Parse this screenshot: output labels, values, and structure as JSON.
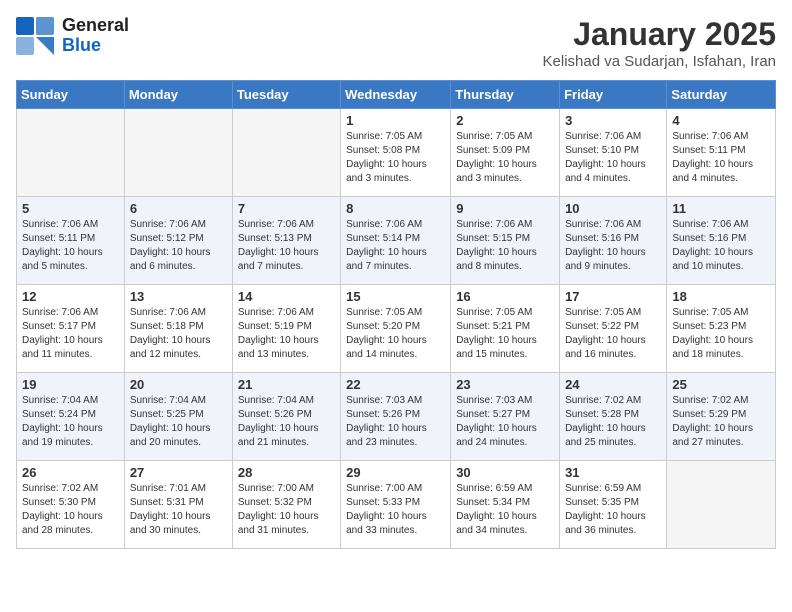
{
  "header": {
    "logo_line1": "General",
    "logo_line2": "Blue",
    "month": "January 2025",
    "location": "Kelishad va Sudarjan, Isfahan, Iran"
  },
  "weekdays": [
    "Sunday",
    "Monday",
    "Tuesday",
    "Wednesday",
    "Thursday",
    "Friday",
    "Saturday"
  ],
  "weeks": [
    [
      {
        "day": "",
        "info": ""
      },
      {
        "day": "",
        "info": ""
      },
      {
        "day": "",
        "info": ""
      },
      {
        "day": "1",
        "info": "Sunrise: 7:05 AM\nSunset: 5:08 PM\nDaylight: 10 hours\nand 3 minutes."
      },
      {
        "day": "2",
        "info": "Sunrise: 7:05 AM\nSunset: 5:09 PM\nDaylight: 10 hours\nand 3 minutes."
      },
      {
        "day": "3",
        "info": "Sunrise: 7:06 AM\nSunset: 5:10 PM\nDaylight: 10 hours\nand 4 minutes."
      },
      {
        "day": "4",
        "info": "Sunrise: 7:06 AM\nSunset: 5:11 PM\nDaylight: 10 hours\nand 4 minutes."
      }
    ],
    [
      {
        "day": "5",
        "info": "Sunrise: 7:06 AM\nSunset: 5:11 PM\nDaylight: 10 hours\nand 5 minutes."
      },
      {
        "day": "6",
        "info": "Sunrise: 7:06 AM\nSunset: 5:12 PM\nDaylight: 10 hours\nand 6 minutes."
      },
      {
        "day": "7",
        "info": "Sunrise: 7:06 AM\nSunset: 5:13 PM\nDaylight: 10 hours\nand 7 minutes."
      },
      {
        "day": "8",
        "info": "Sunrise: 7:06 AM\nSunset: 5:14 PM\nDaylight: 10 hours\nand 7 minutes."
      },
      {
        "day": "9",
        "info": "Sunrise: 7:06 AM\nSunset: 5:15 PM\nDaylight: 10 hours\nand 8 minutes."
      },
      {
        "day": "10",
        "info": "Sunrise: 7:06 AM\nSunset: 5:16 PM\nDaylight: 10 hours\nand 9 minutes."
      },
      {
        "day": "11",
        "info": "Sunrise: 7:06 AM\nSunset: 5:16 PM\nDaylight: 10 hours\nand 10 minutes."
      }
    ],
    [
      {
        "day": "12",
        "info": "Sunrise: 7:06 AM\nSunset: 5:17 PM\nDaylight: 10 hours\nand 11 minutes."
      },
      {
        "day": "13",
        "info": "Sunrise: 7:06 AM\nSunset: 5:18 PM\nDaylight: 10 hours\nand 12 minutes."
      },
      {
        "day": "14",
        "info": "Sunrise: 7:06 AM\nSunset: 5:19 PM\nDaylight: 10 hours\nand 13 minutes."
      },
      {
        "day": "15",
        "info": "Sunrise: 7:05 AM\nSunset: 5:20 PM\nDaylight: 10 hours\nand 14 minutes."
      },
      {
        "day": "16",
        "info": "Sunrise: 7:05 AM\nSunset: 5:21 PM\nDaylight: 10 hours\nand 15 minutes."
      },
      {
        "day": "17",
        "info": "Sunrise: 7:05 AM\nSunset: 5:22 PM\nDaylight: 10 hours\nand 16 minutes."
      },
      {
        "day": "18",
        "info": "Sunrise: 7:05 AM\nSunset: 5:23 PM\nDaylight: 10 hours\nand 18 minutes."
      }
    ],
    [
      {
        "day": "19",
        "info": "Sunrise: 7:04 AM\nSunset: 5:24 PM\nDaylight: 10 hours\nand 19 minutes."
      },
      {
        "day": "20",
        "info": "Sunrise: 7:04 AM\nSunset: 5:25 PM\nDaylight: 10 hours\nand 20 minutes."
      },
      {
        "day": "21",
        "info": "Sunrise: 7:04 AM\nSunset: 5:26 PM\nDaylight: 10 hours\nand 21 minutes."
      },
      {
        "day": "22",
        "info": "Sunrise: 7:03 AM\nSunset: 5:26 PM\nDaylight: 10 hours\nand 23 minutes."
      },
      {
        "day": "23",
        "info": "Sunrise: 7:03 AM\nSunset: 5:27 PM\nDaylight: 10 hours\nand 24 minutes."
      },
      {
        "day": "24",
        "info": "Sunrise: 7:02 AM\nSunset: 5:28 PM\nDaylight: 10 hours\nand 25 minutes."
      },
      {
        "day": "25",
        "info": "Sunrise: 7:02 AM\nSunset: 5:29 PM\nDaylight: 10 hours\nand 27 minutes."
      }
    ],
    [
      {
        "day": "26",
        "info": "Sunrise: 7:02 AM\nSunset: 5:30 PM\nDaylight: 10 hours\nand 28 minutes."
      },
      {
        "day": "27",
        "info": "Sunrise: 7:01 AM\nSunset: 5:31 PM\nDaylight: 10 hours\nand 30 minutes."
      },
      {
        "day": "28",
        "info": "Sunrise: 7:00 AM\nSunset: 5:32 PM\nDaylight: 10 hours\nand 31 minutes."
      },
      {
        "day": "29",
        "info": "Sunrise: 7:00 AM\nSunset: 5:33 PM\nDaylight: 10 hours\nand 33 minutes."
      },
      {
        "day": "30",
        "info": "Sunrise: 6:59 AM\nSunset: 5:34 PM\nDaylight: 10 hours\nand 34 minutes."
      },
      {
        "day": "31",
        "info": "Sunrise: 6:59 AM\nSunset: 5:35 PM\nDaylight: 10 hours\nand 36 minutes."
      },
      {
        "day": "",
        "info": ""
      }
    ]
  ]
}
